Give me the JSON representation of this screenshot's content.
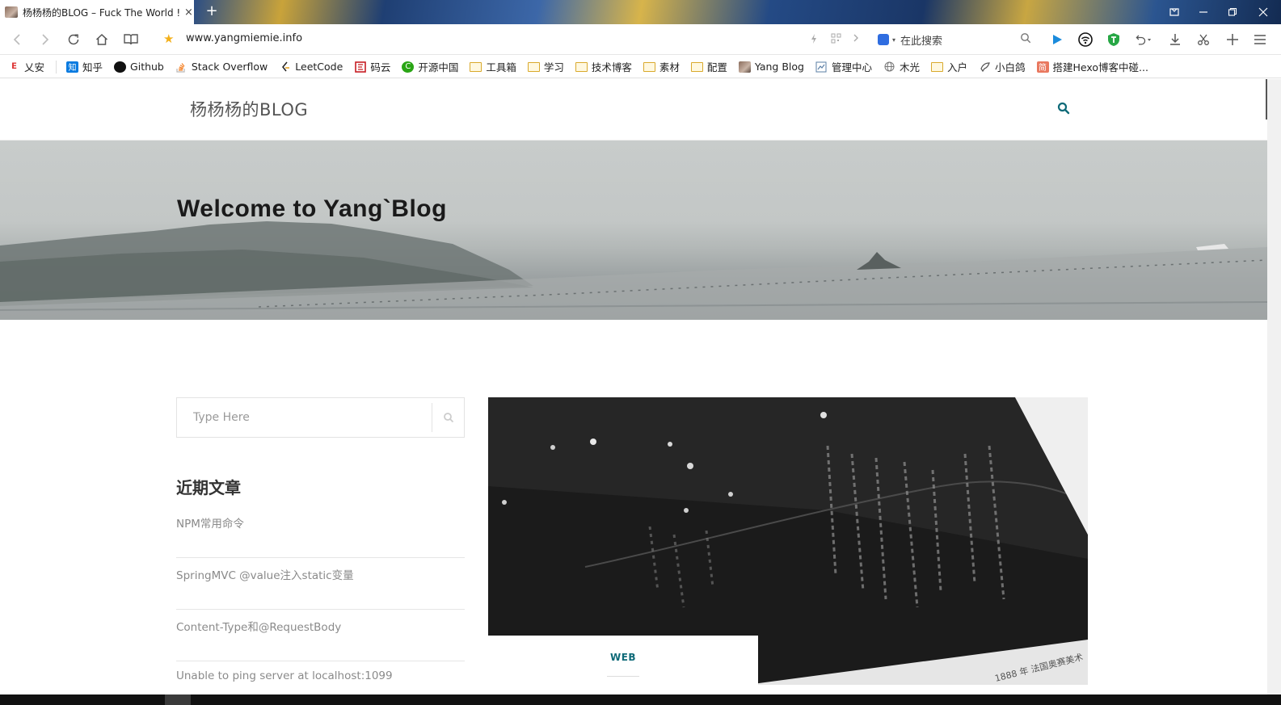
{
  "browser": {
    "tab_title": "杨杨杨的BLOG – Fuck The World !",
    "tab_close": "×",
    "new_tab": "+",
    "window_controls": [
      "minimize",
      "restore",
      "close"
    ],
    "url": "www.yangmiemie.info",
    "search_placeholder": "在此搜索",
    "accent": "#f3b01a"
  },
  "bookmarks": [
    {
      "label": "乂安",
      "icon": "xian-icon",
      "color": "#d33"
    },
    {
      "label": "知乎",
      "icon": "zhihu-icon",
      "color": "#0a7be0"
    },
    {
      "label": "Github",
      "icon": "github-icon",
      "color": "#111"
    },
    {
      "label": "Stack Overflow",
      "icon": "stackoverflow-icon",
      "color": "#f48024"
    },
    {
      "label": "LeetCode",
      "icon": "leetcode-icon",
      "color": "#e6a11a"
    },
    {
      "label": "码云",
      "icon": "gitee-icon",
      "color": "#c71d23"
    },
    {
      "label": "开源中国",
      "icon": "oschina-icon",
      "color": "#2aa515"
    },
    {
      "label": "工具箱",
      "icon": "folder-icon"
    },
    {
      "label": "学习",
      "icon": "folder-icon"
    },
    {
      "label": "技术博客",
      "icon": "folder-icon"
    },
    {
      "label": "素材",
      "icon": "folder-icon"
    },
    {
      "label": "配置",
      "icon": "folder-icon"
    },
    {
      "label": "Yang Blog",
      "icon": "yangblog-icon",
      "color": "#8a6d5c"
    },
    {
      "label": "管理中心",
      "icon": "admin-icon",
      "color": "#5b7fa6"
    },
    {
      "label": "木光",
      "icon": "globe-icon",
      "color": "#777"
    },
    {
      "label": "入户",
      "icon": "folder-icon"
    },
    {
      "label": "小白鸽",
      "icon": "dove-icon",
      "color": "#555"
    },
    {
      "label": "搭建Hexo博客中碰...",
      "icon": "jianshu-icon",
      "color": "#e9785f"
    }
  ],
  "site": {
    "title": "杨杨杨的BLOG",
    "hero_title": "Welcome to Yang`Blog",
    "accent": "#0e6a78"
  },
  "sidebar": {
    "search_placeholder": "Type Here",
    "recent_heading": "近期文章",
    "recent_posts": [
      "NPM常用命令",
      "SpringMVC @value注入static变量",
      "Content-Type和@RequestBody",
      "Unable to ping server at localhost:1099"
    ]
  },
  "post": {
    "category": "WEB"
  }
}
